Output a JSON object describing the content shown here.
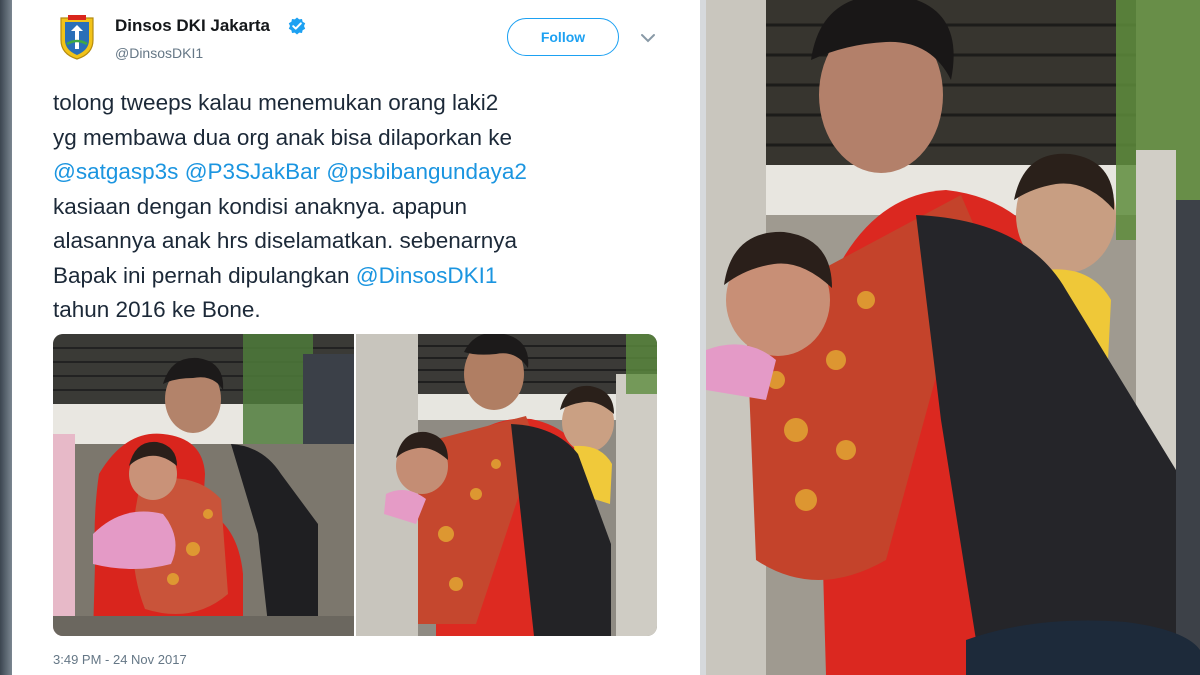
{
  "tweet": {
    "display_name": "Dinsos DKI Jakarta",
    "handle": "@DinsosDKI1",
    "follow_label": "Follow",
    "text_lines": [
      [
        {
          "text": "tolong tweeps kalau menemukan orang laki2"
        }
      ],
      [
        {
          "text": "yg membawa dua org anak bisa dilaporkan ke"
        }
      ],
      [
        {
          "text": "@satgasp3s",
          "mention": true
        },
        {
          "text": " "
        },
        {
          "text": "@P3SJakBar",
          "mention": true
        },
        {
          "text": " "
        },
        {
          "text": "@psbibangundaya2",
          "mention": true
        }
      ],
      [
        {
          "text": "kasiaan dengan kondisi anaknya. apapun"
        }
      ],
      [
        {
          "text": "alasannya anak hrs diselamatkan. sebenarnya"
        }
      ],
      [
        {
          "text": "Bapak ini pernah dipulangkan "
        },
        {
          "text": "@DinsosDKI1",
          "mention": true
        }
      ],
      [
        {
          "text": "tahun 2016 ke Bone."
        }
      ]
    ],
    "timestamp": "3:49 PM - 24 Nov 2017"
  },
  "icons": {
    "avatar": "dki-jakarta-crest-icon",
    "verified": "verified-badge-icon",
    "menu": "chevron-down-icon"
  },
  "colors": {
    "link": "#1b95e0",
    "follow": "#1da1f2",
    "text": "#1c2938",
    "muted": "#657786"
  }
}
